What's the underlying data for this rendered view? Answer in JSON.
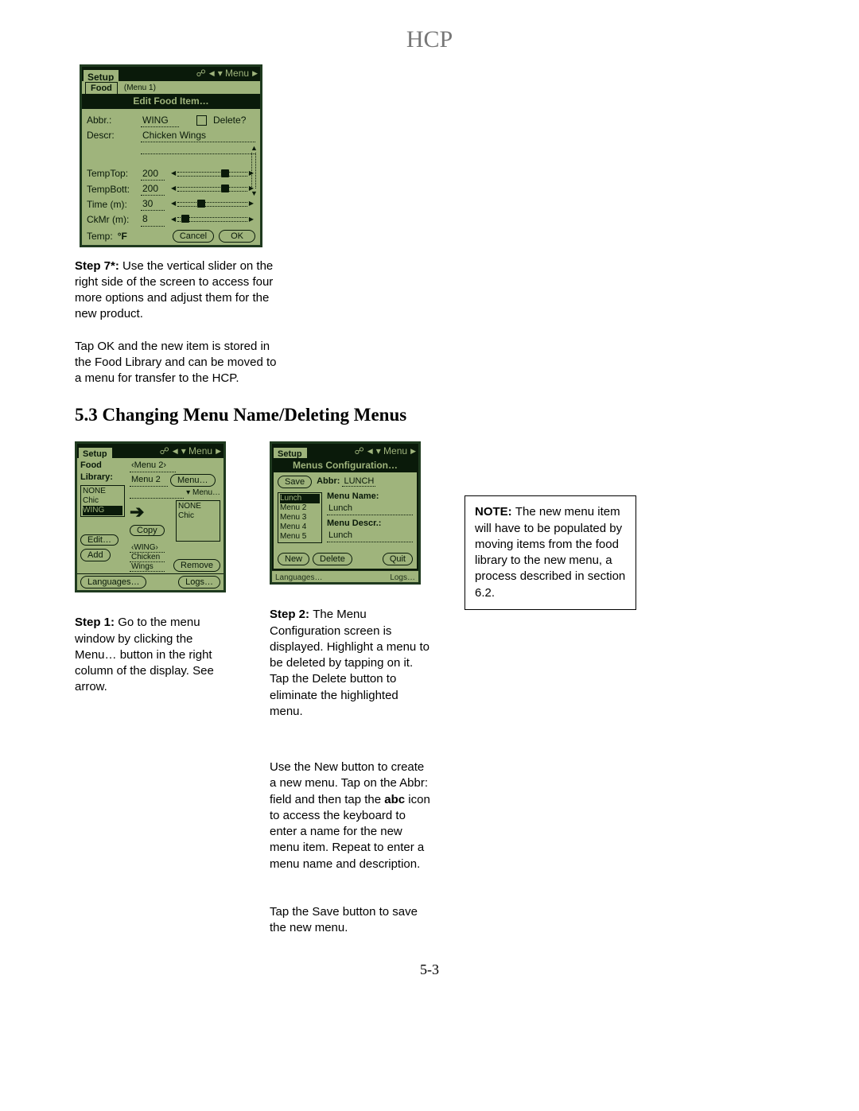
{
  "hcp": "HCP",
  "page_no": "5-3",
  "section_heading": "5.3 Changing Menu Name/Deleting Menus",
  "screen1": {
    "setup": "Setup",
    "menu_label": "Menu",
    "food_tab": "Food",
    "behind_tab": "(Menu 1)",
    "modal_title": "Edit Food Item…",
    "abbr_lbl": "Abbr.:",
    "abbr_val": "WING",
    "delete_lbl": "Delete?",
    "descr_lbl": "Descr:",
    "descr_val": "Chicken Wings",
    "temptop_lbl": "TempTop:",
    "temptop_val": "200",
    "tempbott_lbl": "TempBott:",
    "tempbott_val": "200",
    "time_lbl": "Time (m):",
    "time_val": "30",
    "ckmr_lbl": "CkMr (m):",
    "ckmr_val": "8",
    "temp_lbl": "Temp:",
    "temp_unit": "°F",
    "cancel": "Cancel",
    "ok": "OK"
  },
  "step7_label": "Step 7*: ",
  "step7_text": "Use the vertical slider on the right side of the screen to access four more options and adjust them for the new product.",
  "step7_p2": "Tap OK and the new item is stored in the Food Library and can be moved to a menu for transfer to the HCP.",
  "screen2": {
    "setup": "Setup",
    "menu_label": "Menu",
    "food_lbl": "Food",
    "library_lbl": "Library:",
    "lib_link1": "‹Menu 2›",
    "lib_link2": "Menu 2",
    "menu_btn": "Menu…",
    "menu_dd": "Menu…",
    "left_list": [
      "NONE",
      "Chic",
      "WING"
    ],
    "right_list": [
      "NONE",
      "Chic"
    ],
    "copy": "Copy",
    "wing": "‹WING›",
    "chicken": "Chicken",
    "wings": "Wings",
    "edit": "Edit…",
    "add": "Add",
    "remove": "Remove",
    "languages": "Languages…",
    "logs": "Logs…"
  },
  "step1_label": "Step 1: ",
  "step1_text": "Go to the menu window by clicking the Menu… button in the right column of the display. See arrow.",
  "screen3": {
    "setup": "Setup",
    "menu_label": "Menu",
    "modal_title": "Menus Configuration…",
    "save": "Save",
    "abbr_lbl": "Abbr:",
    "abbr_val": "LUNCH",
    "menu_name_lbl": "Menu Name:",
    "menu_name_val": "Lunch",
    "menu_descr_lbl": "Menu Descr.:",
    "menu_descr_val": "Lunch",
    "list": [
      "Lunch",
      "Menu 2",
      "Menu 3",
      "Menu 4",
      "Menu 5"
    ],
    "new": "New",
    "delete": "Delete",
    "quit": "Quit",
    "languages": "Languages…",
    "logs": "Logs…"
  },
  "step2_label": "Step 2: ",
  "step2_text": "The Menu Configuration screen is displayed. Highlight a menu to be deleted by tapping on it. Tap the Delete button to eliminate the highlighted menu.",
  "mid_para_a": "Use the New button to create a new menu. Tap on the Abbr: field and then tap the ",
  "mid_para_bold": "abc",
  "mid_para_b": " icon to access the keyboard to enter a name for the new menu item. Repeat to enter a menu name and description.",
  "mid_para2": "Tap the Save button to save the new menu.",
  "note_label": "NOTE: ",
  "note_text": "The new menu item will have to be populated by moving items from the food library to the new menu, a process described in section 6.2."
}
